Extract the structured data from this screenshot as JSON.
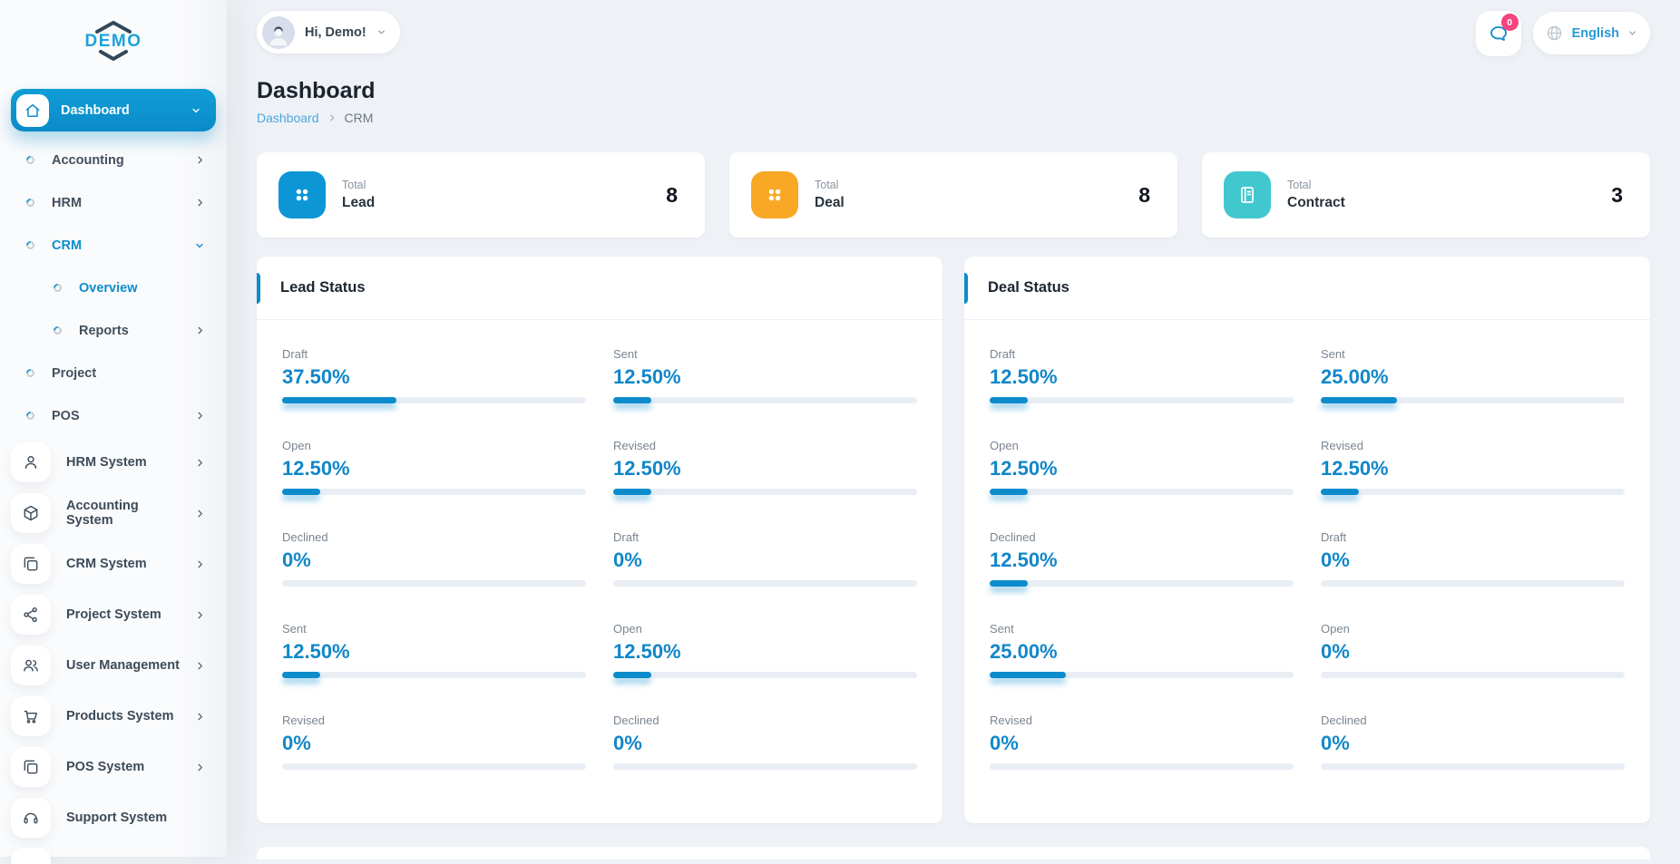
{
  "brand": {
    "name": "DEMO"
  },
  "topbar": {
    "greeting": "Hi, Demo!",
    "notification_badge": "0",
    "language": "English"
  },
  "page": {
    "title": "Dashboard",
    "breadcrumb_home": "Dashboard",
    "breadcrumb_current": "CRM"
  },
  "sidebar": {
    "items": [
      {
        "label": "Dashboard"
      },
      {
        "label": "Accounting"
      },
      {
        "label": "HRM"
      },
      {
        "label": "CRM"
      },
      {
        "label": "Overview"
      },
      {
        "label": "Reports"
      },
      {
        "label": "Project"
      },
      {
        "label": "POS"
      },
      {
        "label": "HRM System"
      },
      {
        "label": "Accounting System"
      },
      {
        "label": "CRM System"
      },
      {
        "label": "Project System"
      },
      {
        "label": "User Management"
      },
      {
        "label": "Products System"
      },
      {
        "label": "POS System"
      },
      {
        "label": "Support System"
      }
    ]
  },
  "stats": [
    {
      "caption": "Total",
      "name": "Lead",
      "value": "8",
      "color": "#0c96d6"
    },
    {
      "caption": "Total",
      "name": "Deal",
      "value": "8",
      "color": "#f9a826"
    },
    {
      "caption": "Total",
      "name": "Contract",
      "value": "3",
      "color": "#41c8cf"
    }
  ],
  "panels": [
    {
      "title": "Lead Status",
      "items": [
        {
          "label": "Draft",
          "value": "37.50%",
          "pct": 37.5
        },
        {
          "label": "Sent",
          "value": "12.50%",
          "pct": 12.5
        },
        {
          "label": "Open",
          "value": "12.50%",
          "pct": 12.5
        },
        {
          "label": "Revised",
          "value": "12.50%",
          "pct": 12.5
        },
        {
          "label": "Declined",
          "value": "0%",
          "pct": 0
        },
        {
          "label": "Draft",
          "value": "0%",
          "pct": 0
        },
        {
          "label": "Sent",
          "value": "12.50%",
          "pct": 12.5
        },
        {
          "label": "Open",
          "value": "12.50%",
          "pct": 12.5
        },
        {
          "label": "Revised",
          "value": "0%",
          "pct": 0
        },
        {
          "label": "Declined",
          "value": "0%",
          "pct": 0
        }
      ]
    },
    {
      "title": "Deal Status",
      "items": [
        {
          "label": "Draft",
          "value": "12.50%",
          "pct": 12.5
        },
        {
          "label": "Sent",
          "value": "25.00%",
          "pct": 25
        },
        {
          "label": "Open",
          "value": "12.50%",
          "pct": 12.5
        },
        {
          "label": "Revised",
          "value": "12.50%",
          "pct": 12.5
        },
        {
          "label": "Declined",
          "value": "12.50%",
          "pct": 12.5
        },
        {
          "label": "Draft",
          "value": "0%",
          "pct": 0
        },
        {
          "label": "Sent",
          "value": "25.00%",
          "pct": 25
        },
        {
          "label": "Open",
          "value": "0%",
          "pct": 0
        },
        {
          "label": "Revised",
          "value": "0%",
          "pct": 0
        },
        {
          "label": "Declined",
          "value": "0%",
          "pct": 0
        }
      ]
    }
  ],
  "colors": {
    "primary_blue": "#0d8ccc",
    "stat_orange": "#f9a826",
    "stat_teal": "#41c8cf",
    "badge_pink": "#f4447e",
    "track_gray": "#e9eef5"
  }
}
